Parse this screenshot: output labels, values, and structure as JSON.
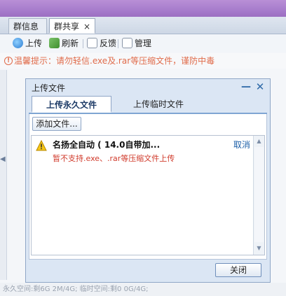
{
  "tabs": [
    {
      "label": "群信息"
    },
    {
      "label": "群共享",
      "close": "×"
    }
  ],
  "toolbar": {
    "upload": "上传",
    "refresh": "刷新",
    "feedback": "反馈",
    "manage": "管理"
  },
  "warning": {
    "icon": "!",
    "text": "温馨提示：请勿轻信.exe及.rar等压缩文件，谨防中毒"
  },
  "dialog": {
    "title": "上传文件",
    "minimize": "—",
    "close": "✕",
    "tabs": [
      {
        "label": "上传永久文件"
      },
      {
        "label": "上传临时文件"
      }
    ],
    "add_button": "添加文件...",
    "file": {
      "name": "名扬全自动 ( 14.0自带加...",
      "cancel": "取消",
      "error": "暂不支持.exe、.rar等压缩文件上传"
    },
    "close_button": "关闭"
  },
  "bottom_text": "永久空间:剩6G  2M/4G;  临时空间:剩0  0G/4G;",
  "colors": {
    "accent": "#2f6aa8",
    "warning": "#e06b4a",
    "error": "#d03a2b"
  }
}
